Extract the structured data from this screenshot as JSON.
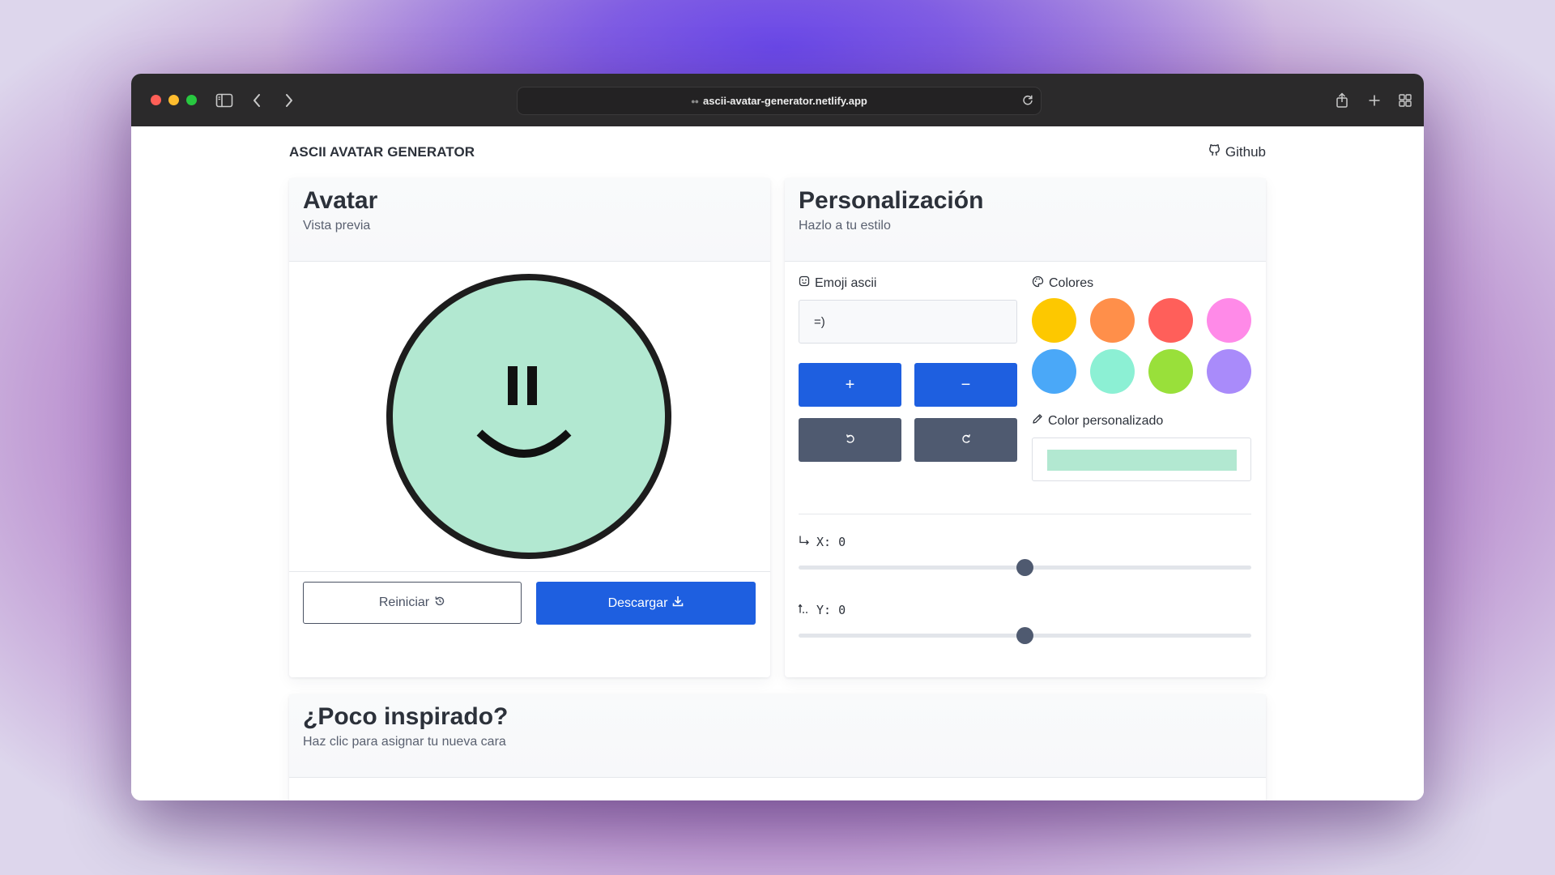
{
  "browser": {
    "url": "ascii-avatar-generator.netlify.app"
  },
  "header": {
    "brand": "ASCII AVATAR GENERATOR",
    "github_label": "Github"
  },
  "avatar_card": {
    "title": "Avatar",
    "subtitle": "Vista previa",
    "emoji": "=)",
    "background_color": "#b2e8d1",
    "reset_label": "Reiniciar",
    "download_label": "Descargar"
  },
  "custom_card": {
    "title": "Personalización",
    "subtitle": "Hazlo a tu estilo",
    "emoji_label": "Emoji ascii",
    "emoji_value": "=)",
    "plus_label": "+",
    "minus_label": "−",
    "colors_label": "Colores",
    "colors": [
      "#fdc800",
      "#ff8f4a",
      "#ff5f5a",
      "#ff8ae8",
      "#4aa8f8",
      "#8cf0d4",
      "#99e03a",
      "#a98bfa"
    ],
    "custom_color_label": "Color personalizado",
    "custom_color_value": "#b2e8d1",
    "x_label": "X: 0",
    "x_value": 0,
    "y_label": "Y: 0",
    "y_value": 0
  },
  "inspiration_card": {
    "title": "¿Poco inspirado?",
    "subtitle": "Haz clic para asignar tu nueva cara"
  }
}
